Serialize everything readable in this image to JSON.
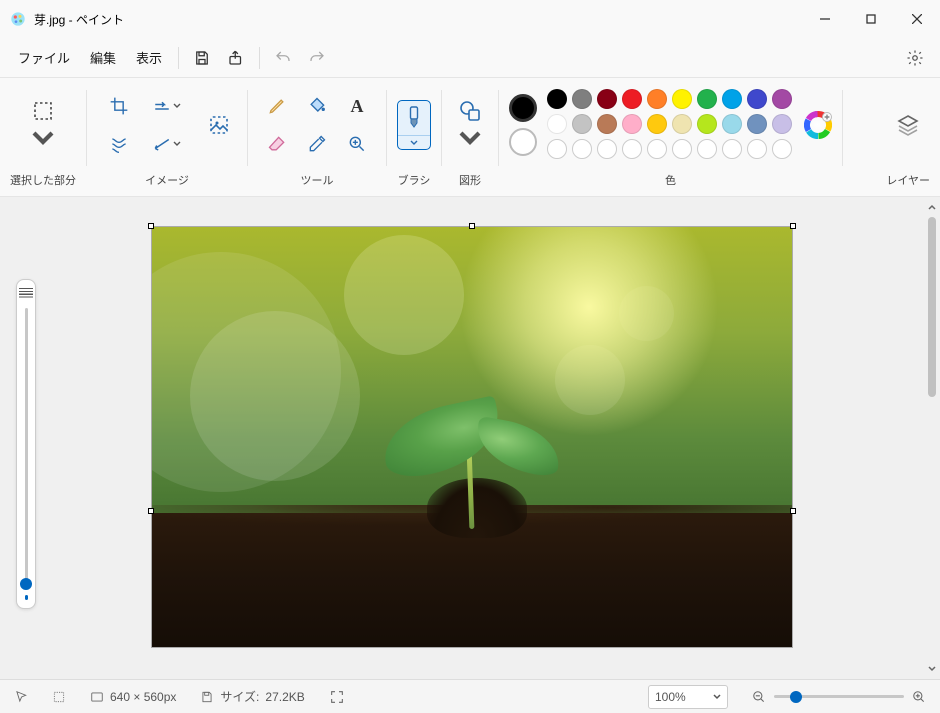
{
  "title": "芽.jpg - ペイント",
  "menu": {
    "file": "ファイル",
    "edit": "編集",
    "view": "表示"
  },
  "ribbon": {
    "selection_label": "選択した部分",
    "image_label": "イメージ",
    "tools_label": "ツール",
    "brushes_label": "ブラシ",
    "shapes_label": "図形",
    "colors_label": "色",
    "layers_label": "レイヤー"
  },
  "colors": {
    "current1": "#000000",
    "current2": "#ffffff",
    "row1": [
      "#000000",
      "#7f7f7f",
      "#880015",
      "#ed1c24",
      "#ff7f27",
      "#fff200",
      "#22b14c",
      "#00a2e8",
      "#3f48cc",
      "#a349a4"
    ],
    "row2": [
      "#ffffff",
      "#c3c3c3",
      "#b97a57",
      "#ffaec9",
      "#ffc90e",
      "#efe4b0",
      "#b5e61d",
      "#99d9ea",
      "#7092be",
      "#c8bfe7"
    ]
  },
  "status": {
    "dimensions": "640 × 560px",
    "filesize_label": "サイズ:",
    "filesize": "27.2KB",
    "zoom": "100%"
  }
}
